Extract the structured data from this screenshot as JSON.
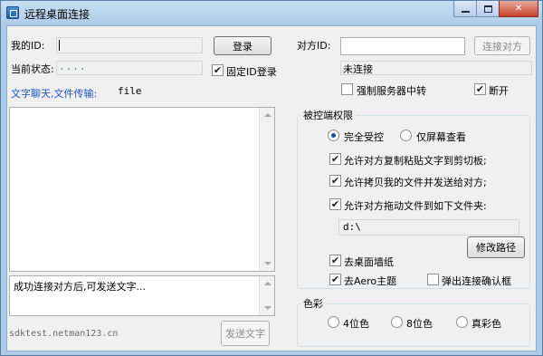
{
  "window": {
    "title": "远程桌面连接",
    "controls": {
      "minimize": "minimize",
      "maximize": "maximize",
      "close": "✕"
    }
  },
  "left": {
    "my_id_label": "我的ID:",
    "my_id_value": "",
    "login_button": "登录",
    "status_label": "当前状态:",
    "status_value": "....",
    "fixed_id_login": {
      "label": "固定ID登录",
      "checked": true
    },
    "chat_label": "文字聊天,文件传输:",
    "file_label": "file",
    "chat_log": "",
    "message_input": "成功连接对方后,可发送文字...",
    "footer_url": "sdktest.netman123.cn",
    "send_button": "发送文字"
  },
  "right": {
    "peer_id_label": "对方ID:",
    "peer_id_value": "",
    "connect_button": "连接对方",
    "connection_status": "未连接",
    "force_relay": {
      "label": "强制服务器中转",
      "checked": false
    },
    "disconnect": {
      "label": "断开",
      "checked": true
    },
    "controlled_perm": {
      "title": "被控端权限",
      "full_control": {
        "label": "完全受控",
        "selected": true
      },
      "view_only": {
        "label": "仅屏幕查看",
        "selected": false
      },
      "allow_copy_text": {
        "label": "允许对方复制粘贴文字到剪切板;",
        "checked": true
      },
      "allow_copy_files": {
        "label": "允许拷贝我的文件并发送给对方;",
        "checked": true
      },
      "allow_drag_files": {
        "label": "允许对方拖动文件到如下文件夹:",
        "checked": true
      },
      "folder_path": "d:\\",
      "modify_path_button": "修改路径",
      "remove_wallpaper": {
        "label": "去桌面墙纸",
        "checked": true
      },
      "remove_aero": {
        "label": "去Aero主题",
        "checked": true
      },
      "popup_confirm": {
        "label": "弹出连接确认框",
        "checked": false
      }
    },
    "color": {
      "title": "色彩",
      "options": [
        {
          "label": "4位色",
          "selected": false
        },
        {
          "label": "8位色",
          "selected": false
        },
        {
          "label": "真彩色",
          "selected": false
        }
      ]
    }
  },
  "check_mark": "✔"
}
